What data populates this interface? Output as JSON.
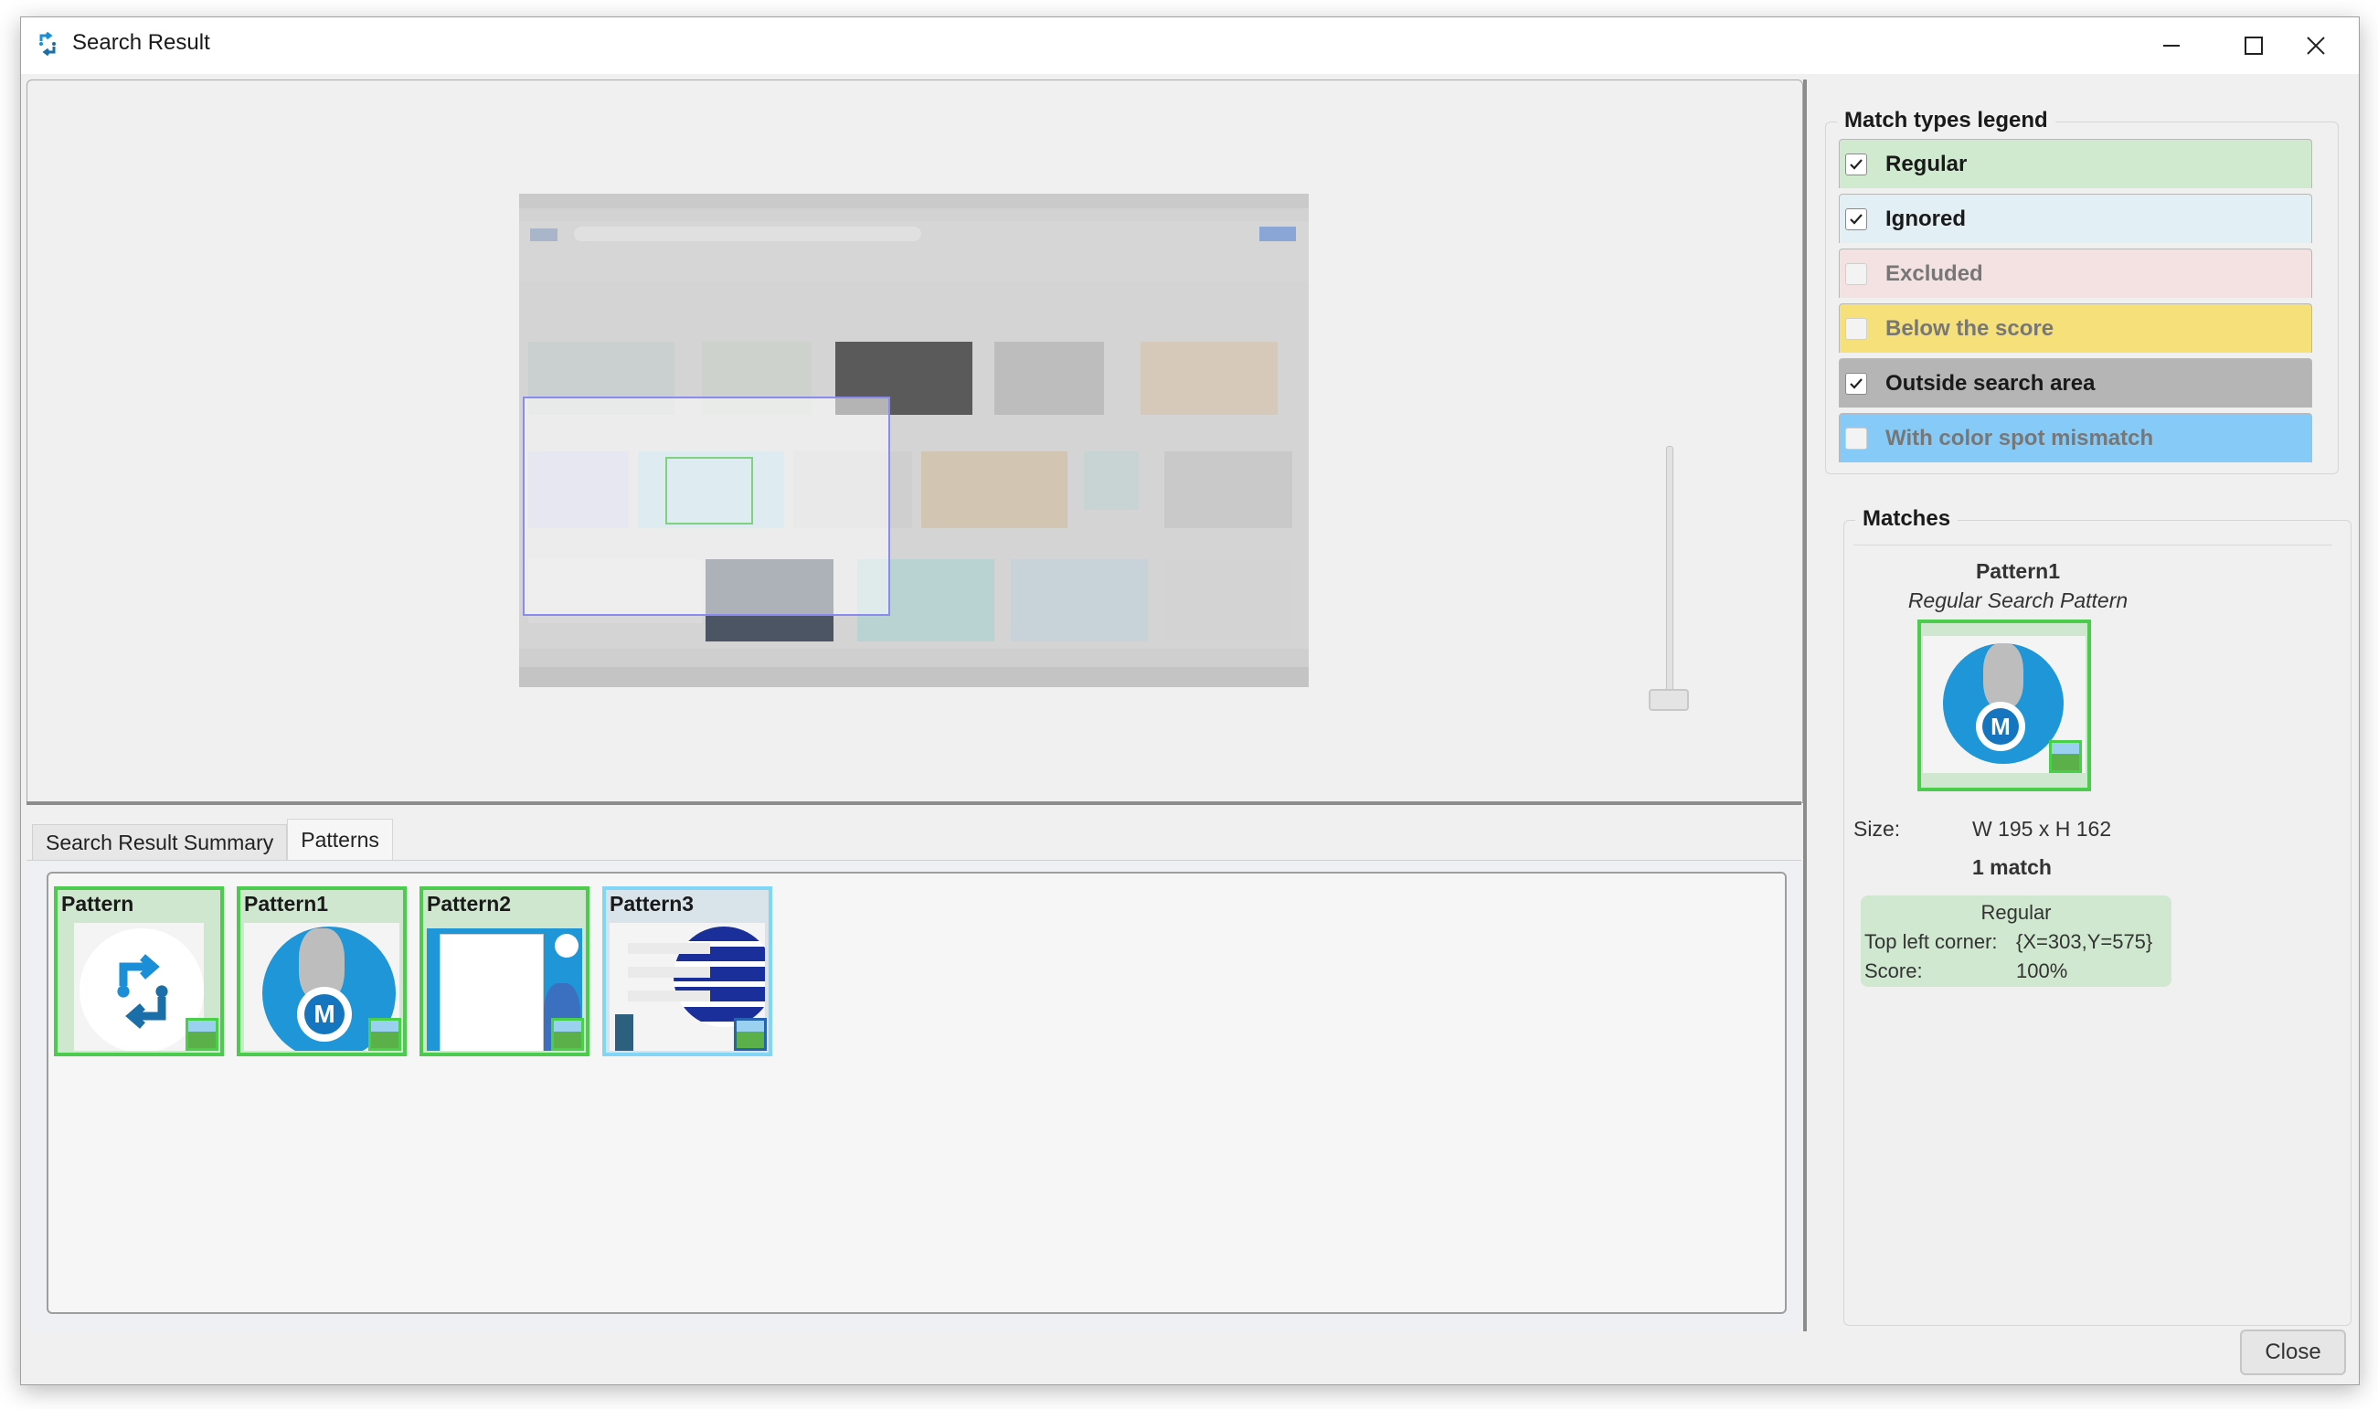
{
  "window": {
    "title": "Search Result",
    "icon": "sync-arrows-icon",
    "controls": [
      "minimize",
      "maximize",
      "close"
    ]
  },
  "preview": {
    "description": "Screenshot of browser image search results with highlighted search area",
    "zoom_slider_value_fraction": 0.0
  },
  "tabs": [
    {
      "label": "Search Result Summary",
      "active": false
    },
    {
      "label": "Patterns",
      "active": true
    }
  ],
  "patterns": [
    {
      "name": "Pattern",
      "status": "Regular",
      "border_color": "#4ccc4c",
      "thumb": "sync-arrows-logo",
      "badge": "image-match-icon"
    },
    {
      "name": "Pattern1",
      "status": "Regular",
      "border_color": "#4ccc4c",
      "thumb": "mascot-circle",
      "badge": "image-match-icon"
    },
    {
      "name": "Pattern2",
      "status": "Regular",
      "border_color": "#4ccc4c",
      "thumb": "mascot-chart",
      "badge": "image-match-icon"
    },
    {
      "name": "Pattern3",
      "status": "With color spot mismatch",
      "border_color": "#7fd6f6",
      "thumb": "mascot-menu",
      "badge": "image-warning-icon"
    }
  ],
  "legend": {
    "title": "Match types legend",
    "items": [
      {
        "label": "Regular",
        "checked": true,
        "color": "#cfeacf"
      },
      {
        "label": "Ignored",
        "checked": true,
        "color": "#e2eff5"
      },
      {
        "label": "Excluded",
        "checked": false,
        "color": "#f4e2e2"
      },
      {
        "label": "Below the score",
        "checked": false,
        "color": "#f5e07a"
      },
      {
        "label": "Outside search area",
        "checked": true,
        "color": "#b5b5b5"
      },
      {
        "label": "With color spot mismatch",
        "checked": false,
        "color": "#86cbf7"
      }
    ]
  },
  "matches": {
    "title": "Matches",
    "pattern_name": "Pattern1",
    "pattern_type": "Regular Search Pattern",
    "size_label": "Size:",
    "size_value": "W 195 x H 162",
    "match_count": "1 match",
    "result": {
      "type": "Regular",
      "top_left_label": "Top left corner:",
      "top_left_value": "{X=303,Y=575}",
      "score_label": "Score:",
      "score_value": "100%"
    }
  },
  "footer": {
    "close_label": "Close"
  }
}
